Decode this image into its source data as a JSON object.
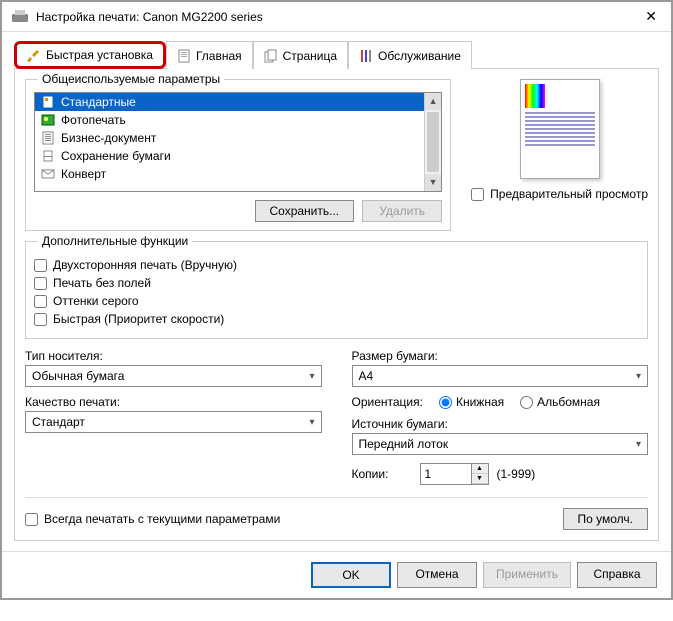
{
  "window": {
    "title": "Настройка печати: Canon MG2200 series"
  },
  "tabs": {
    "quick": "Быстрая установка",
    "main": "Главная",
    "page": "Страница",
    "service": "Обслуживание"
  },
  "presets": {
    "legend": "Общеиспользуемые параметры",
    "items": {
      "standard": "Стандартные",
      "photo": "Фотопечать",
      "business": "Бизнес-документ",
      "papersave": "Сохранение бумаги",
      "envelope": "Конверт"
    },
    "save": "Сохранить...",
    "delete": "Удалить"
  },
  "preview": {
    "checkbox": "Предварительный просмотр"
  },
  "extra": {
    "legend": "Дополнительные функции",
    "duplex": "Двухсторонняя печать (Вручную)",
    "borderless": "Печать без полей",
    "grayscale": "Оттенки серого",
    "fast": "Быстрая (Приоритет скорости)"
  },
  "media": {
    "type_label": "Тип носителя:",
    "type_value": "Обычная бумага",
    "quality_label": "Качество печати:",
    "quality_value": "Стандарт"
  },
  "paper": {
    "size_label": "Размер бумаги:",
    "size_value": "A4",
    "orient_label": "Ориентация:",
    "portrait": "Книжная",
    "landscape": "Альбомная",
    "source_label": "Источник бумаги:",
    "source_value": "Передний лоток",
    "copies_label": "Копии:",
    "copies_value": "1",
    "copies_range": "(1-999)"
  },
  "footer": {
    "always": "Всегда печатать с текущими параметрами",
    "defaults": "По умолч."
  },
  "buttons": {
    "ok": "OK",
    "cancel": "Отмена",
    "apply": "Применить",
    "help": "Справка"
  }
}
